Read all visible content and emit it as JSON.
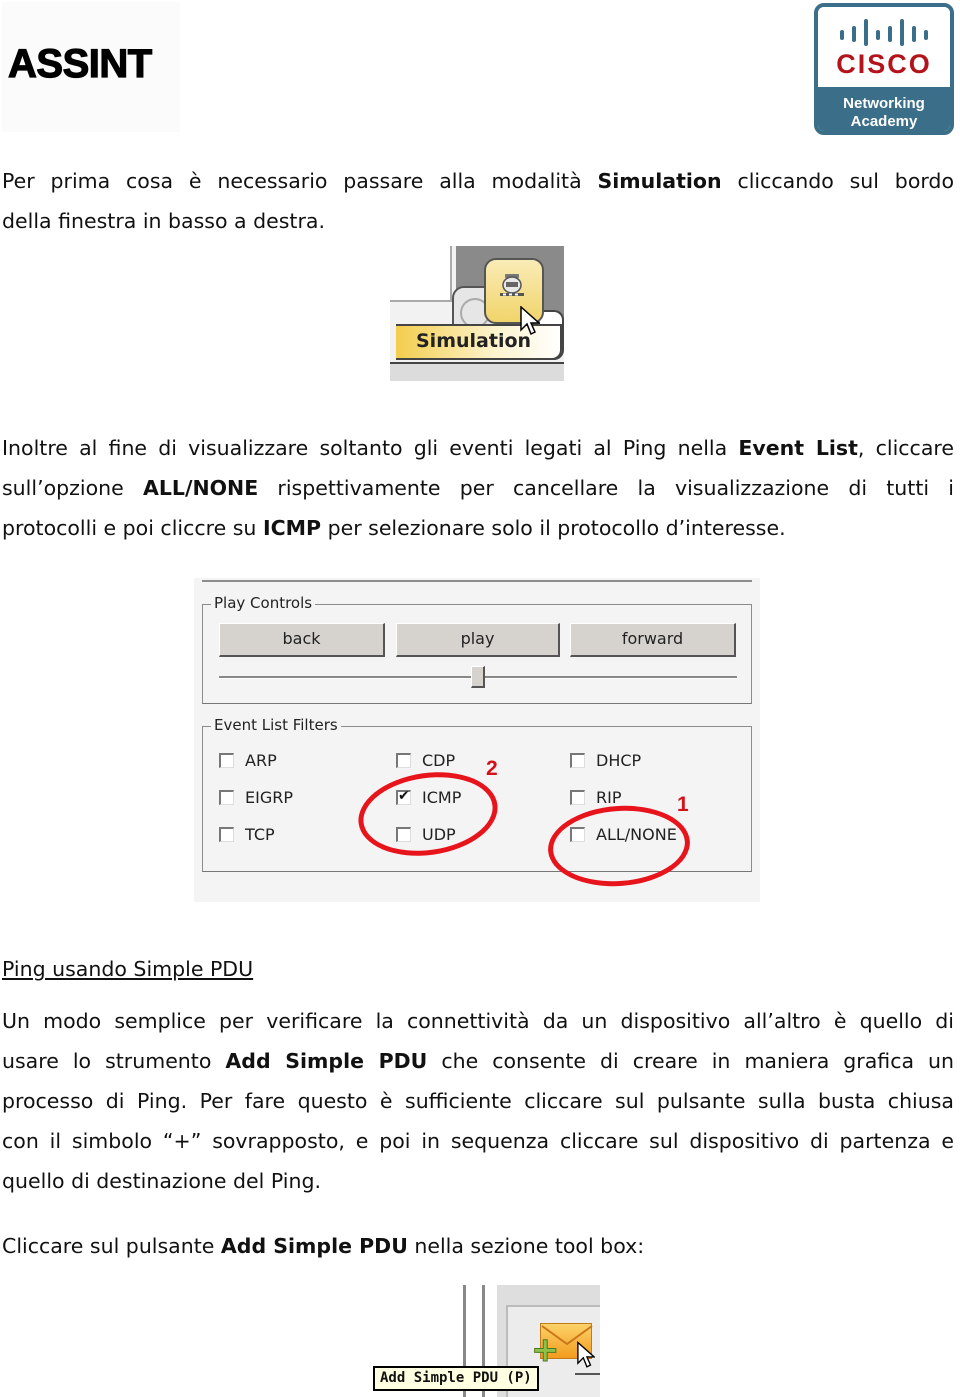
{
  "header": {
    "brand": "ASSINT",
    "logo": {
      "word": "CISCO",
      "line1": "Networking",
      "line2": "Academy",
      "colors": {
        "red": "#b3131a",
        "teal": "#3b6e88"
      }
    }
  },
  "para1": {
    "line1": [
      "Per prima cosa è necessario passare alla modalità ",
      "Simulation",
      " cliccando sul bordo"
    ],
    "line2": "della finestra in basso a destra."
  },
  "simulation_image": {
    "tab_label": "Simulation",
    "icons": [
      "clock-icon",
      "train-icon",
      "cursor-icon"
    ]
  },
  "para2": {
    "line1": [
      "Inoltre al fine di visualizzare soltanto gli eventi legati al Ping nella ",
      "Event List",
      ", cliccare"
    ],
    "line2": [
      "sull’opzione ",
      "ALL/NONE",
      " rispettivamente per cancellare la visualizzazione di tutti i"
    ],
    "line3": [
      "protocolli e poi cliccre su ",
      "ICMP",
      " per selezionare solo il protocollo d’interesse."
    ]
  },
  "play_controls": {
    "legend": "Play Controls",
    "buttons": {
      "back": "back",
      "play": "play",
      "forward": "forward"
    },
    "slider_value_percent": 50
  },
  "event_filters": {
    "legend": "Event List Filters",
    "items": [
      {
        "label": "ARP",
        "checked": false
      },
      {
        "label": "CDP",
        "checked": false
      },
      {
        "label": "DHCP",
        "checked": false
      },
      {
        "label": "EIGRP",
        "checked": false
      },
      {
        "label": "ICMP",
        "checked": true
      },
      {
        "label": "RIP",
        "checked": false
      },
      {
        "label": "TCP",
        "checked": false
      },
      {
        "label": "UDP",
        "checked": false
      },
      {
        "label": "ALL/NONE",
        "checked": false
      }
    ],
    "annotations": {
      "step1": "1",
      "step2": "2",
      "color": "#e8141c"
    }
  },
  "section": {
    "heading": "Ping usando Simple PDU"
  },
  "para3": {
    "line1": "Un modo semplice per verificare la connettività da un dispositivo all’altro è quello di",
    "line2": [
      "usare lo strumento ",
      "Add Simple PDU",
      " che consente di creare in maniera grafica un"
    ],
    "line3": "processo di Ping. Per fare questo è sufficiente cliccare sul pulsante sulla busta chiusa",
    "line4": "con il simbolo “+” sovrapposto, e poi in sequenza cliccare sul dispositivo di partenza e",
    "line5": "quello di destinazione del Ping."
  },
  "para4": [
    "Cliccare sul pulsante ",
    "Add Simple PDU",
    " nella sezione tool box:"
  ],
  "pdu_image": {
    "tooltip": "Add Simple PDU (P)",
    "icons": [
      "envelope-plus-icon",
      "cursor-icon"
    ]
  }
}
